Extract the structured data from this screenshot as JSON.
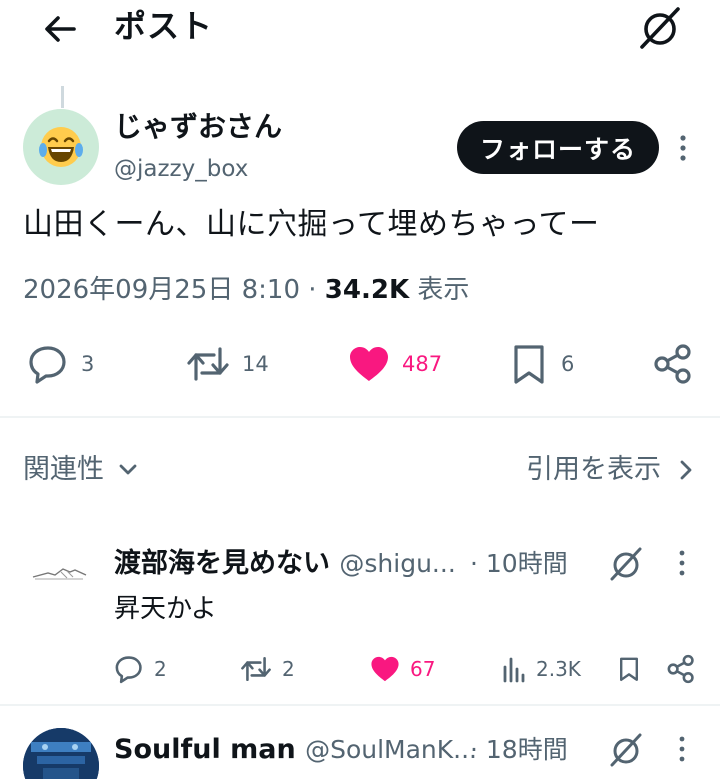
{
  "header": {
    "title": "ポスト",
    "icons": {
      "back": "arrow-left-icon",
      "grok": "grok-icon"
    }
  },
  "tweet": {
    "author_name": "じゃずおさん",
    "author_handle": "@jazzy_box",
    "avatar_icon": "laughing-tears-emoji",
    "follow_label": "フォローする",
    "text": "山田くーん、山に穴掘って埋めちゃってー",
    "timestamp": "2026年09月25日 8:10",
    "separator": "·",
    "views_count": "34.2K",
    "views_label": "表示",
    "reply_count": "3",
    "retweet_count": "14",
    "like_count": "487",
    "bookmark_count": "6",
    "liked": true
  },
  "related_label": "関連性",
  "quotes_label": "引用を表示",
  "replies": [
    {
      "name": "渡部海を見めない",
      "handle": "@shigu...",
      "time": "· 10時間",
      "text": "昇天かよ",
      "reply_count": "2",
      "retweet_count": "2",
      "like_count": "67",
      "views_count": "2.3K",
      "liked": true
    },
    {
      "name": "Soulful man",
      "handle": "@SoulManK...",
      "time": "· 18時間"
    }
  ],
  "colors": {
    "text_primary": "#0f1419",
    "text_secondary": "#536471",
    "like_pink": "#f91880",
    "avatar_bg": "#ccebd8",
    "divider": "#eff3f4"
  }
}
